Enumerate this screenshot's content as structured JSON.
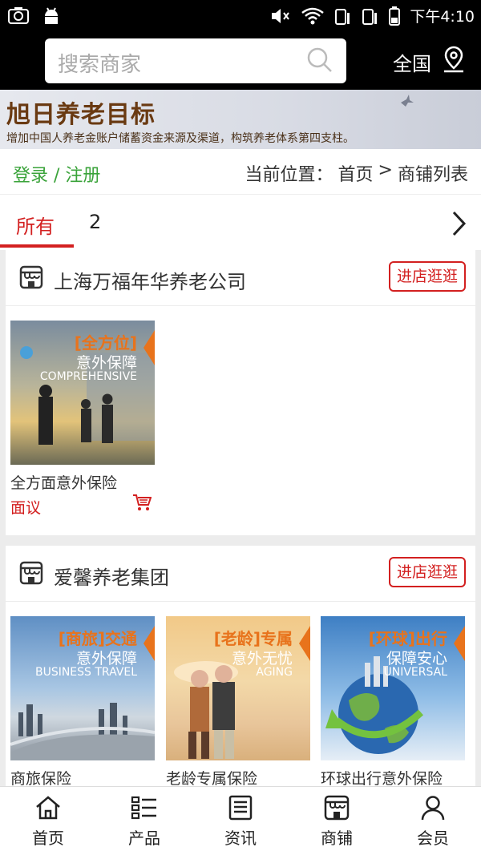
{
  "status": {
    "time": "下午4:10"
  },
  "search": {
    "placeholder": "搜索商家"
  },
  "region": {
    "label": "全国"
  },
  "banner": {
    "title": "旭日养老目标",
    "subtitle": "增加中国人养老金账户储蓄资金来源及渠道，构筑养老体系第四支柱。"
  },
  "breadcrumb": {
    "login": "登录 / 注册",
    "prefix": "当前位置：",
    "home": "首页",
    "sep": ">",
    "current": "商铺列表"
  },
  "tabs": [
    {
      "label": "所有"
    },
    {
      "label": "2"
    }
  ],
  "shops": [
    {
      "name": "上海万福年华养老公司",
      "enter_label": "进店逛逛",
      "products": [
        {
          "name": "全方面意外保险",
          "price": "面议",
          "img_tag": "[全方位]",
          "img_line": "意外保障",
          "img_en": "COMPREHENSIVE"
        }
      ]
    },
    {
      "name": "爱馨养老集团",
      "enter_label": "进店逛逛",
      "products": [
        {
          "name": "商旅保险",
          "img_tag": "[商旅]交通",
          "img_line": "意外保障",
          "img_en": "BUSINESS TRAVEL"
        },
        {
          "name": "老龄专属保险",
          "img_tag": "[老龄]专属",
          "img_line": "意外无忧",
          "img_en": "AGING"
        },
        {
          "name": "环球出行意外保险",
          "img_tag": "[环球]出行",
          "img_line": "保障安心",
          "img_en": "UNIVERSAL"
        }
      ]
    }
  ],
  "nav": [
    {
      "label": "首页",
      "icon": "home-icon"
    },
    {
      "label": "产品",
      "icon": "list-icon"
    },
    {
      "label": "资讯",
      "icon": "news-icon"
    },
    {
      "label": "商铺",
      "icon": "store-icon"
    },
    {
      "label": "会员",
      "icon": "user-icon"
    }
  ],
  "colors": {
    "accent": "#d32020",
    "login": "#3aa33a",
    "banner_title": "#6a3a12"
  }
}
